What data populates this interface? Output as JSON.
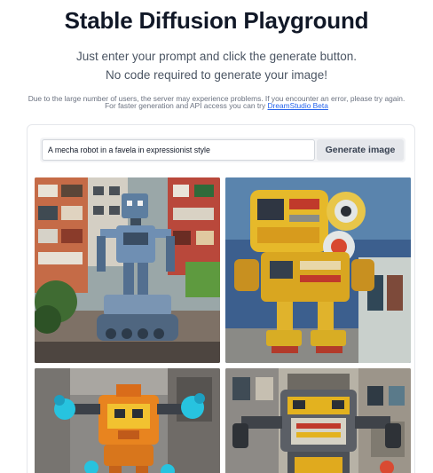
{
  "header": {
    "title": "Stable Diffusion Playground",
    "subtitle_line1": "Just enter your prompt and click the generate button.",
    "subtitle_line2": "No code required to generate your image!"
  },
  "notice": {
    "server_warning": "Due to the large number of users, the server may experience problems. If you encounter an error, please try again.",
    "faster_text": "For faster generation and API access you can try",
    "faster_link": "DreamStudio Beta"
  },
  "form": {
    "prompt_value": "A mecha robot in a favela in expressionist style",
    "generate_label": "Generate image"
  },
  "gallery": {
    "images": [
      {
        "subject": "blue-grey mecha robot on treads among favela buildings"
      },
      {
        "subject": "yellow expressionist painted mecha robot"
      },
      {
        "subject": "orange robot with cyan hands against a wall"
      },
      {
        "subject": "grey and yellow robot in painted favela alley"
      }
    ]
  }
}
